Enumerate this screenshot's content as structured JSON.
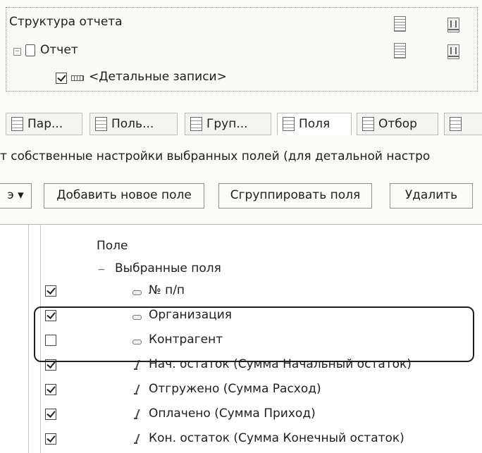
{
  "structure": {
    "title": "Структура отчета",
    "report_node": "Отчет",
    "detail_node": "<Детальные записи>"
  },
  "tabs": [
    {
      "label": "Пар...",
      "icon": "parameters-icon"
    },
    {
      "label": "Поль...",
      "icon": "user-fields-icon"
    },
    {
      "label": "Груп...",
      "icon": "grouping-icon"
    },
    {
      "label": "Поля",
      "icon": "fields-icon"
    },
    {
      "label": "Отбор",
      "icon": "filter-icon"
    }
  ],
  "description": "т собственные настройки выбранных полей (для детальной настро",
  "toolbar": {
    "more_label": "э ▾",
    "add_field": "Добавить новое поле",
    "group_fields": "Сгруппировать поля",
    "delete": "Удалить"
  },
  "fields_table": {
    "column_header": "Поле",
    "group_label": "Выбранные поля",
    "rows": [
      {
        "label": "№ п/п",
        "checked": true,
        "icon": "field-icon"
      },
      {
        "label": "Организация",
        "checked": true,
        "icon": "field-icon"
      },
      {
        "label": "Контрагент",
        "checked": false,
        "icon": "field-icon"
      },
      {
        "label": "Нач. остаток (Сумма Начальный остаток)",
        "checked": true,
        "icon": "function-icon"
      },
      {
        "label": "Отгружено (Сумма Расход)",
        "checked": true,
        "icon": "function-icon"
      },
      {
        "label": "Оплачено (Сумма Приход)",
        "checked": true,
        "icon": "function-icon"
      },
      {
        "label": "Кон. остаток (Сумма Конечный остаток)",
        "checked": true,
        "icon": "function-icon"
      }
    ]
  }
}
